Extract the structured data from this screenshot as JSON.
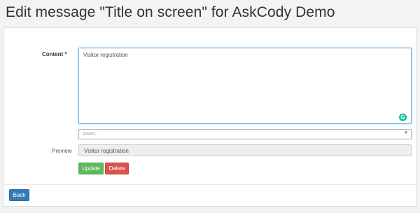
{
  "page": {
    "title": "Edit message \"Title on screen\" for AskCody Demo"
  },
  "form": {
    "content_label": "Content *",
    "content_value": "Visitor registration",
    "insert_placeholder": "Insert...",
    "preview_label": "Preview",
    "preview_value": "Visitor registration",
    "grammarly_glyph": "G"
  },
  "buttons": {
    "update": "Update",
    "delete": "Delete",
    "back": "Back"
  },
  "colors": {
    "update": "#5cb85c",
    "delete": "#d9534f",
    "back": "#337ab7",
    "grammarly": "#15c39a"
  },
  "icons": {
    "textarea_badge": "grammarly-icon",
    "select_toggle": "chevron-down-icon"
  }
}
